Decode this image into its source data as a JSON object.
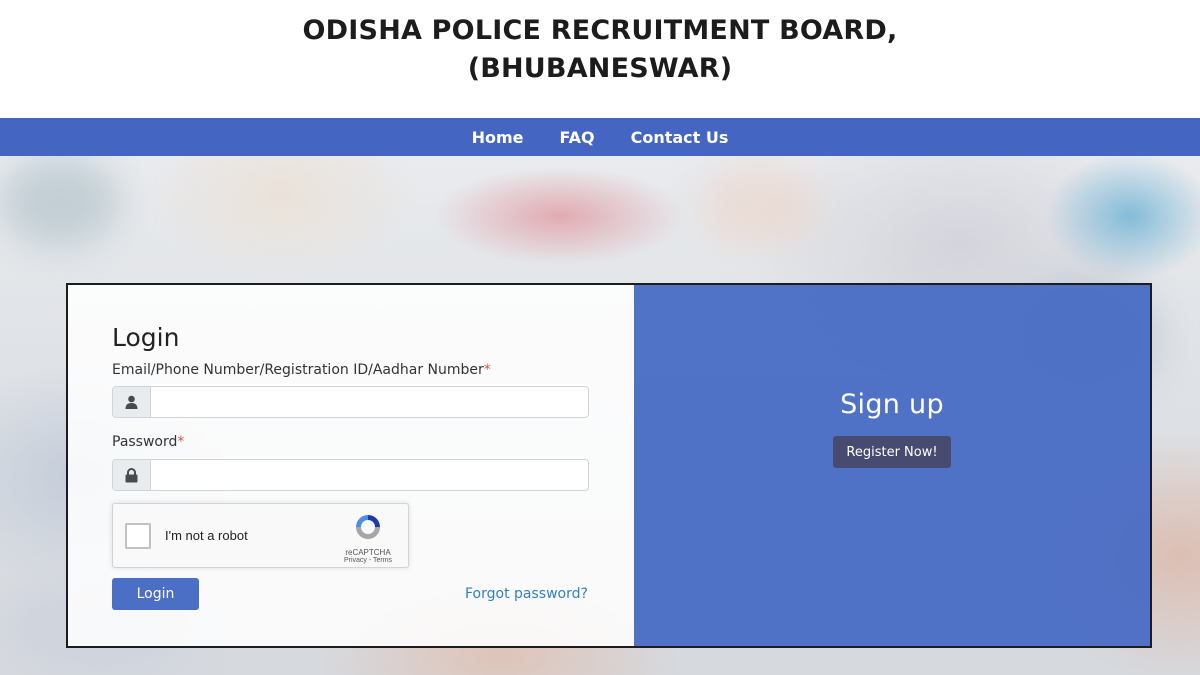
{
  "header": {
    "title_line1": "ODISHA POLICE RECRUITMENT BOARD,",
    "title_line2": "(BHUBANESWAR)"
  },
  "nav": {
    "items": [
      {
        "label": "Home"
      },
      {
        "label": "FAQ"
      },
      {
        "label": "Contact Us"
      }
    ]
  },
  "login": {
    "title": "Login",
    "username_label": "Email/Phone Number/Registration ID/Aadhar Number",
    "username_value": "",
    "password_label": "Password",
    "password_value": "",
    "required_marker": "*",
    "user_icon": "user-icon",
    "lock_icon": "lock-icon",
    "captcha": {
      "text": "I'm not a robot",
      "brand": "reCAPTCHA",
      "links": "Privacy - Terms",
      "checked": false
    },
    "submit_label": "Login",
    "forgot_label": "Forgot password?"
  },
  "signup": {
    "title": "Sign up",
    "button_label": "Register Now!"
  },
  "colors": {
    "nav_bg": "#4466c2",
    "signup_bg": "#4569c4",
    "login_button": "#4a6fc4",
    "register_button": "#474b70",
    "link": "#2f7fc6",
    "required": "#d9534f"
  }
}
